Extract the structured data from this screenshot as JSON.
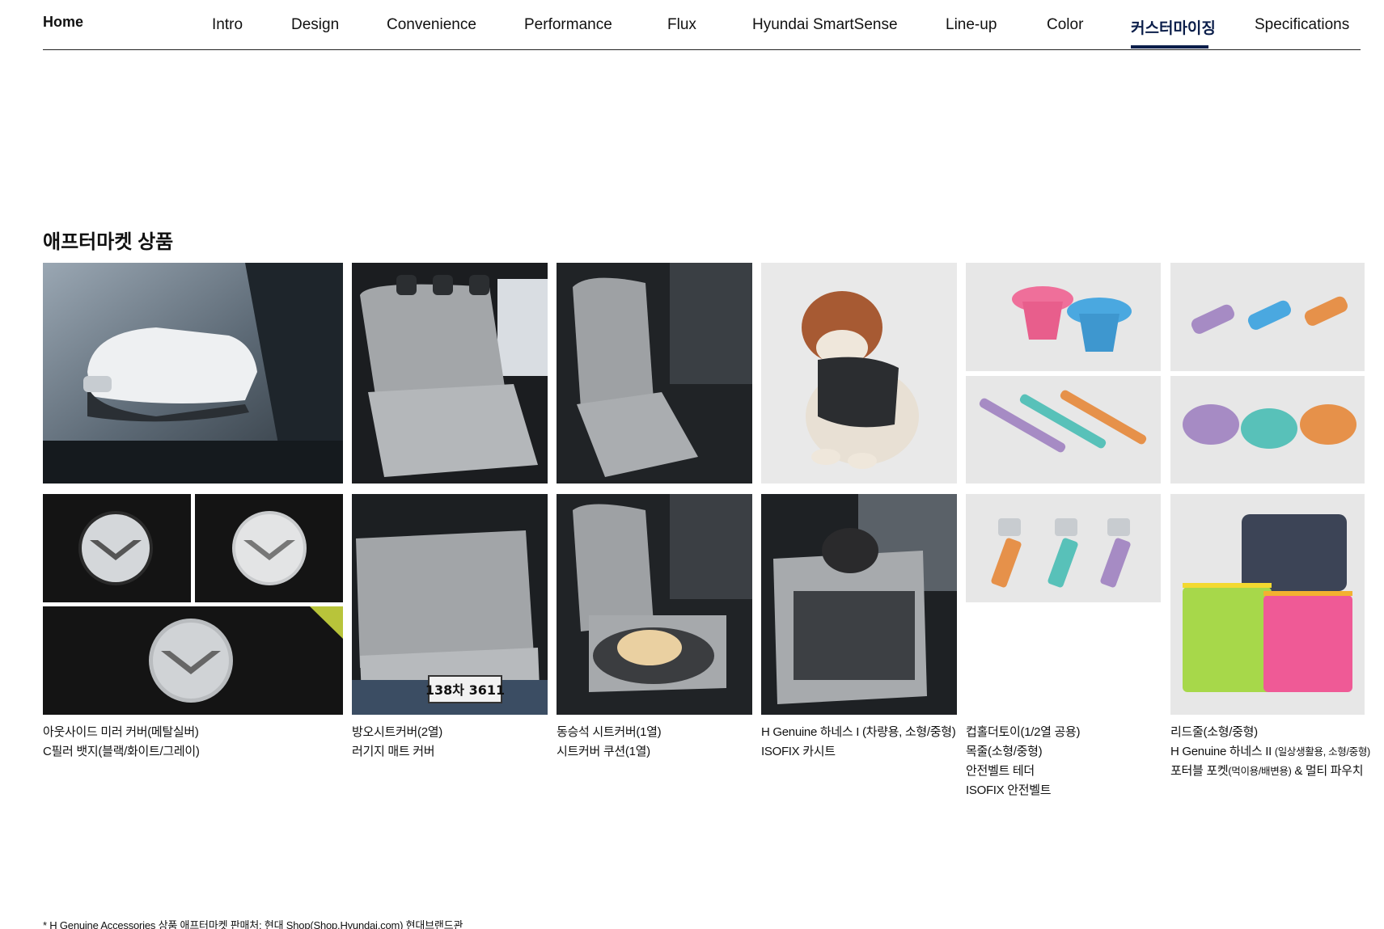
{
  "nav": {
    "home": "Home",
    "tabs": [
      {
        "label": "Intro"
      },
      {
        "label": "Design"
      },
      {
        "label": "Convenience"
      },
      {
        "label": "Performance"
      },
      {
        "label": "Flux"
      },
      {
        "label": "Hyundai SmartSense"
      },
      {
        "label": "Line-up"
      },
      {
        "label": "Color"
      },
      {
        "label": "커스터마이징"
      },
      {
        "label": "Specifications"
      }
    ],
    "active_tab": "커스터마이징"
  },
  "section": {
    "title": "애프터마켓 상품"
  },
  "plate_text": "138차 3611",
  "captions": [
    {
      "lines": [
        "아웃사이드 미러 커버(메탈실버)",
        "C필러 뱃지(블랙/화이트/그레이)"
      ]
    },
    {
      "lines": [
        "방오시트커버(2열)",
        "러기지 매트 커버"
      ]
    },
    {
      "lines": [
        "동승석 시트커버(1열)",
        "시트커버 쿠션(1열)"
      ]
    },
    {
      "lines": [
        "H Genuine 하네스 I (차량용, 소형/중형)",
        "ISOFIX 카시트"
      ]
    },
    {
      "lines": [
        "컵홀더토이(1/2열 공용)",
        "목줄(소형/중형)",
        "안전벨트 테더",
        "ISOFIX 안전벨트"
      ]
    },
    {
      "lines": [
        "리드줄(소형/중형)",
        "H Genuine 하네스 II",
        "포터블 포켓"
      ],
      "smalls": [
        "(일상생활용, 소형/중형)",
        "(먹이용/배변용)"
      ],
      "tail": " & 멀티 파우치"
    }
  ],
  "footnote": "* H Genuine Accessories 상품 애프터마켓 판매처: 현대 Shop(Shop.Hyundai.com) 현대브랜드관",
  "colors": {
    "accent_navy": "#0b1e4a",
    "pink": "#ef6f9a",
    "blue": "#4aa8e0",
    "purple": "#a68bc4",
    "teal": "#58c1b9",
    "orange": "#e6914a",
    "lime": "#a7d84a"
  }
}
